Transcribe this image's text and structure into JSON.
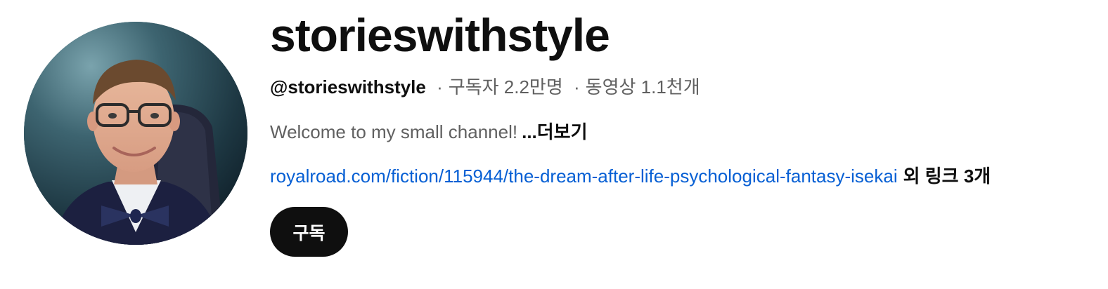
{
  "channel": {
    "name": "storieswithstyle",
    "handle": "@storieswithstyle",
    "separator": "·",
    "subscribers": "구독자 2.2만명",
    "videos": "동영상 1.1천개",
    "description": "Welcome to my small channel!",
    "more_label": "...더보기",
    "link_text": "royalroad.com/fiction/115944/the-dream-after-life-psychological-fantasy-isekai",
    "more_links_label": "외 링크 3개",
    "subscribe_label": "구독",
    "avatar_icon": "channel-avatar-portrait"
  },
  "colors": {
    "title": "#0f0f0f",
    "secondary_text": "#606060",
    "link": "#065fd4",
    "subscribe_bg": "#0f0f0f",
    "subscribe_text": "#ffffff"
  }
}
